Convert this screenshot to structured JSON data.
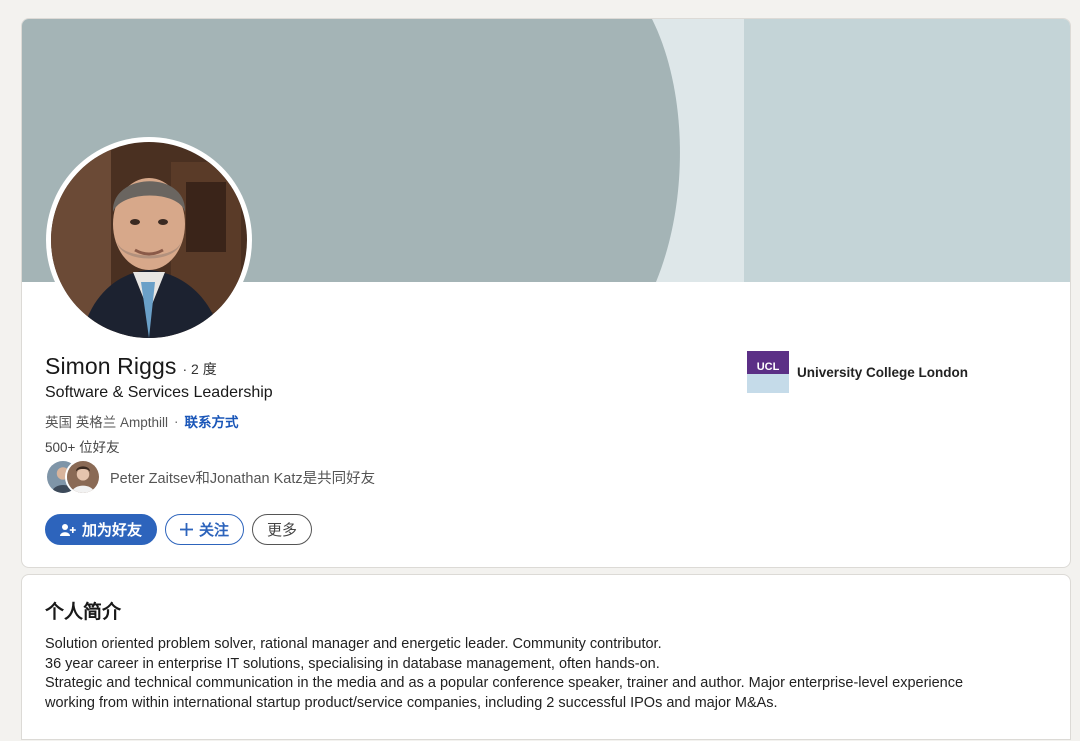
{
  "profile": {
    "name": "Simon Riggs",
    "degree": "· 2 度",
    "headline": "Software & Services Leadership",
    "location": "英国 英格兰 Ampthill",
    "location_separator": "·",
    "contact_info_label": "联系方式",
    "connections": "500+ 位好友",
    "mutual_text": "Peter Zaitsev和Jonathan Katz是共同好友",
    "actions": {
      "connect_label": "加为好友",
      "follow_label": "关注",
      "more_label": "更多"
    },
    "education": {
      "school_name": "University College London",
      "logo_text": "UCL"
    }
  },
  "about": {
    "title": "个人简介",
    "lines": [
      "Solution oriented problem solver, rational manager and energetic leader. Community contributor.",
      "36 year career in enterprise IT solutions, specialising in database management, often hands-on.",
      "Strategic and technical communication in the media and as a popular conference speaker, trainer and author. Major enterprise-level experience",
      "working from within international startup product/service companies, including 2 successful IPOs and major M&As."
    ]
  },
  "colors": {
    "accent_blue": "#2d64bc",
    "banner_dark": "#a4b4b6",
    "banner_light": "#c4d4d7",
    "ucl_purple": "#5b2f86"
  }
}
